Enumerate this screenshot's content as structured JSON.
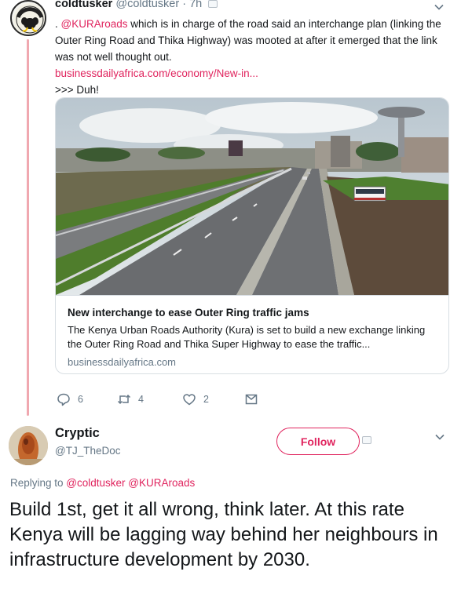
{
  "parent_tweet": {
    "name": "coldtusker",
    "handle": "@coldtusker",
    "time": "· 7h",
    "avatar_text": "COLDTUSKER",
    "text_prefix": ". ",
    "mention": "@KURAroads",
    "text_main": " which is in charge of the road said an interchange plan (linking the Outer Ring Road and Thika Highway) was mooted at after it emerged that the link was not well thought out.",
    "link": "businessdailyafrica.com/economy/New-in...",
    "text_suffix": ">>> Duh!",
    "card": {
      "title": "New interchange to ease Outer Ring traffic jams",
      "description": "The Kenya Urban Roads Authority (Kura) is set to build a new exchange linking the Outer Ring Road and Thika Super Highway to ease the traffic...",
      "domain": "businessdailyafrica.com"
    },
    "actions": {
      "replies": "6",
      "retweets": "4",
      "likes": "2"
    }
  },
  "reply_tweet": {
    "name": "Cryptic",
    "handle": "@TJ_TheDoc",
    "follow_label": "Follow",
    "replying_prefix": "Replying to ",
    "replying_to": "@coldtusker @KURAroads",
    "text": "Build 1st, get it all wrong, think later. At this rate Kenya will be lagging way behind her neighbours in infrastructure development by 2030."
  },
  "colors": {
    "accent": "#e0245e",
    "thread_line": "#f0a8b0",
    "muted_text": "#657786",
    "border": "#d8dee3"
  }
}
